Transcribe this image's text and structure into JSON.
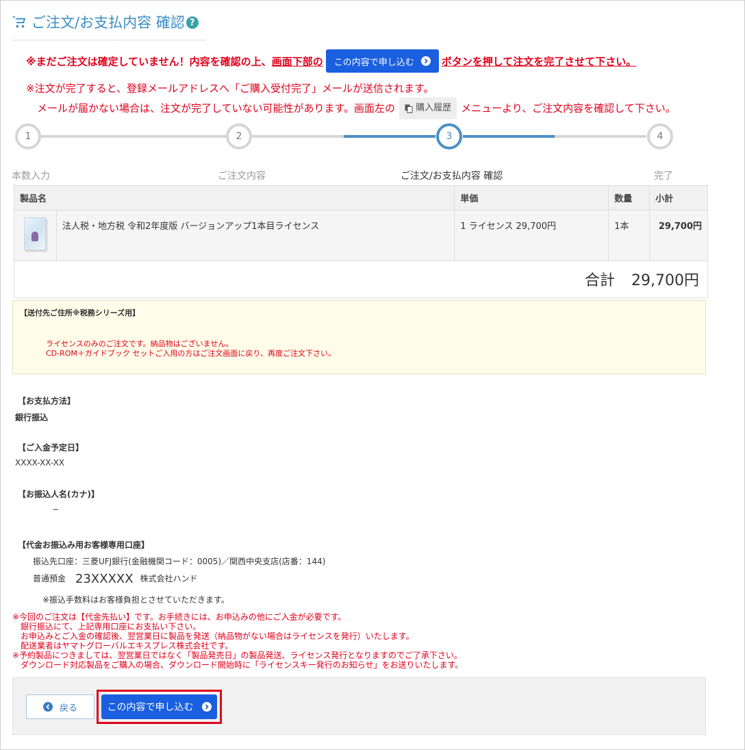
{
  "title": "ご注文/お支払内容 確認",
  "help_icon": "?",
  "warning_top": {
    "part1": "※まだご注文は確定していません！内容を確認の上、",
    "part2": "画面下部の",
    "button_label": "この内容で申し込む",
    "part3": "ボタンを押して注文を完了させて下さい。"
  },
  "warning_info": {
    "line1": "※注文が完了すると、登録メールアドレスへ「ご購入受付完了」メールが送信されます。",
    "line2_a": "メールが届かない場合は、注文が完了していない可能性があります。画面左の",
    "history_label": "購入履歴",
    "line2_b": "メニューより、ご注文内容を確認して下さい。"
  },
  "steps": [
    {
      "num": "1",
      "label": "本数入力"
    },
    {
      "num": "2",
      "label": "ご注文内容"
    },
    {
      "num": "3",
      "label": "ご注文/お支払内容 確認"
    },
    {
      "num": "4",
      "label": "完了"
    }
  ],
  "table": {
    "headers": {
      "name": "製品名",
      "price": "単価",
      "qty": "数量",
      "subtotal": "小計"
    },
    "rows": [
      {
        "name": "法人税・地方税 令和2年度版 バージョンアップ1本目ライセンス",
        "price": "1 ライセンス 29,700円",
        "qty": "1本",
        "subtotal": "29,700円"
      }
    ],
    "total_label": "合計",
    "total_value": "29,700円"
  },
  "shipping": {
    "heading": "【送付先ご住所※税務シリーズ用】",
    "line1": "ライセンスのみのご注文です。納品物はございません。",
    "line2": "CD-ROM＋ガイドブック セットご入用の方はご注文画面に戻り、再度ご注文下さい。"
  },
  "payment": {
    "method_heading": "【お支払方法】",
    "method_value": "銀行振込",
    "date_heading": "【ご入金予定日】",
    "date_value": "XXXX-XX-XX",
    "name_heading": "【お振込人名(カナ)】",
    "name_value": "−",
    "account_heading": "【代金お振込み用お客様専用口座】",
    "bank_line": "振込先口座：三菱UFJ銀行(金融機関コード：0005)／関西中央支店(店番：144)",
    "acct_type": "普通預金",
    "acct_number": "23XXXXX",
    "acct_holder": "株式会社ハンド",
    "fee_note": "※振込手数料はお客様負担とさせていただきます。"
  },
  "notes": [
    "※今回のご注文は【代金先払い】です。お手続きには、お申込みの他にご入金が必要です。",
    "銀行振込にて、上記専用口座にお支払い下さい。",
    "お申込みとご入金の確認後、翌営業日に製品を発送（納品物がない場合はライセンスを発行）いたします。",
    "配送業者はヤマトグローバルエキスプレス株式会社です。",
    "※予約製品につきましては、翌営業日ではなく「製品発売日」の製品発送、ライセンス発行となりますのでご了承下さい。",
    "ダウンロード対応製品をご購入の場合、ダウンロード開始時に「ライセンスキー発行のお知らせ」をお送りいたします。"
  ],
  "footer": {
    "back_label": "戻る",
    "submit_label": "この内容で申し込む"
  },
  "colors": {
    "accent": "#3a8cc5",
    "primary_button": "#1a5fe0",
    "warning": "#e0001b",
    "step_active": "#4a8fc4"
  }
}
